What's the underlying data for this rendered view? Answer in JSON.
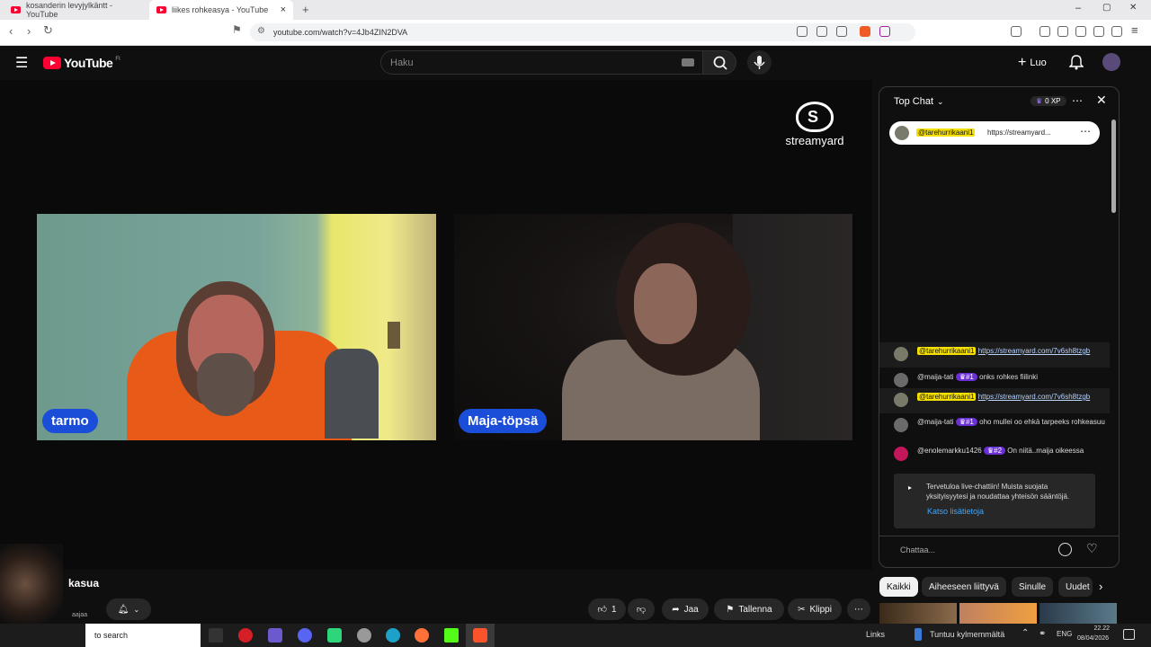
{
  "browser": {
    "tabs": [
      {
        "title": "kosanderin levyjylkäntt - YouTube",
        "active": false
      },
      {
        "title": "liikes rohkeasya - YouTube",
        "active": true
      }
    ],
    "new_tab": "+",
    "url": "youtube.com/watch?v=4Jb4ZIN2DVA",
    "window_controls": [
      "–",
      "▢",
      "✕"
    ]
  },
  "youtube": {
    "logo_text": "YouTube",
    "logo_region": "FI",
    "search_placeholder": "Haku",
    "create_label": "Luo"
  },
  "video": {
    "watermark": "streamyard",
    "participants": [
      {
        "name": "tarmo"
      },
      {
        "name": "Maja-töpsä"
      }
    ]
  },
  "chat": {
    "title": "Top Chat",
    "xp": "0 XP",
    "pinned": {
      "user": "@tarehurrikaani1",
      "text": "https://streamyard..."
    },
    "messages": [
      {
        "user": "@tarehurrikaani1",
        "badge": "",
        "text": "https://streamyard.com/7v6sh8tzgb",
        "highlight": true
      },
      {
        "user": "@maija-tati",
        "badge": "#1",
        "text": "onks rohkes fiilinki",
        "highlight": false
      },
      {
        "user": "@tarehurrikaani1",
        "badge": "",
        "text": "https://streamyard.com/7v6sh8tzgb",
        "highlight": true
      },
      {
        "user": "@maija-tati",
        "badge": "#1",
        "text": "oho mullei oo ehkä tarpeeks rohkeasuu",
        "highlight": false
      },
      {
        "user": "@enolemarkku1426",
        "badge": "#2",
        "text": "On niitä..maija oikeessa",
        "highlight": false
      }
    ],
    "notice_text": "Tervetuloa live-chattiin! Muista suojata yksityisyytesi ja noudattaa yhteisön sääntöjä.",
    "notice_link": "Katso lisätietoja",
    "input_placeholder": "Chattaa..."
  },
  "below": {
    "title_fragment": "kasua",
    "subs_fragment": "aajaa",
    "like_count": "1",
    "share_label": "Jaa",
    "save_label": "Tallenna",
    "clip_label": "Klippi",
    "chips": [
      "Kaikki",
      "Aiheeseen liittyvä",
      "Sinulle",
      "Uudet"
    ]
  },
  "taskbar": {
    "search_text": "to search",
    "links_label": "Links",
    "weather_text": "Tuntuu kylmemmältä",
    "lang": "ENG",
    "time": "22.22",
    "date": "08/04/2026"
  },
  "colors": {
    "accent": "#1a4ed8",
    "youtube_red": "#ff0033",
    "highlight": "#f5e000",
    "badge": "#6b2fd6"
  }
}
